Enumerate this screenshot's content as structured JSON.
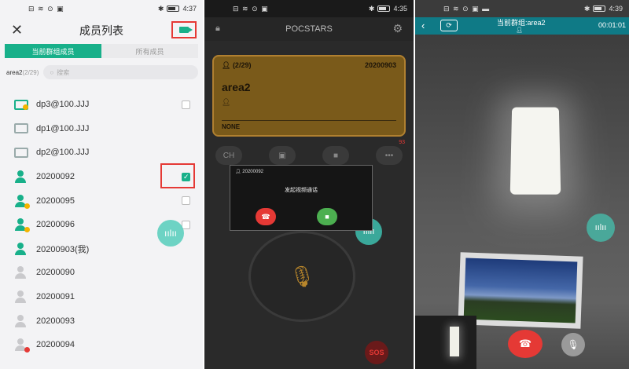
{
  "panel1": {
    "status_time": "4:37",
    "title": "成员列表",
    "tab_current": "当前群组成员",
    "tab_all": "所有成员",
    "area_label": "area2",
    "area_count": "(2/29)",
    "search_placeholder": "搜索",
    "members": [
      {
        "name": "dp3@100.JJJ",
        "icon": "device-online-icon"
      },
      {
        "name": "dp1@100.JJJ",
        "icon": "device-offline-icon"
      },
      {
        "name": "dp2@100.JJJ",
        "icon": "device-offline-icon"
      },
      {
        "name": "20200092",
        "icon": "user-online-icon"
      },
      {
        "name": "20200095",
        "icon": "user-busy-icon"
      },
      {
        "name": "20200096",
        "icon": "user-busy-icon"
      },
      {
        "name": "20200903(我)",
        "icon": "user-online-icon"
      },
      {
        "name": "20200090",
        "icon": "user-offline-icon"
      },
      {
        "name": "20200091",
        "icon": "user-offline-icon"
      },
      {
        "name": "20200093",
        "icon": "user-offline-icon"
      },
      {
        "name": "20200094",
        "icon": "user-dnd-icon"
      }
    ]
  },
  "panel2": {
    "status_time": "4:35",
    "app_title": "POCSTARS",
    "group_count": "(2/29)",
    "user_id": "20200903",
    "group_name": "area2",
    "speaker": "NONE",
    "ctrl_ch": "CH",
    "msg_badge": "93",
    "call_caller": "20200092",
    "call_title": "发起视频通话",
    "sos_label": "SOS"
  },
  "panel3": {
    "status_time": "4:39",
    "title": "当前群组:area2",
    "timer": "00:01:01"
  },
  "colors": {
    "accent": "#18b08a",
    "highlight": "#e53935",
    "card": "#7a5a1a",
    "video_header": "#0f7a86"
  }
}
